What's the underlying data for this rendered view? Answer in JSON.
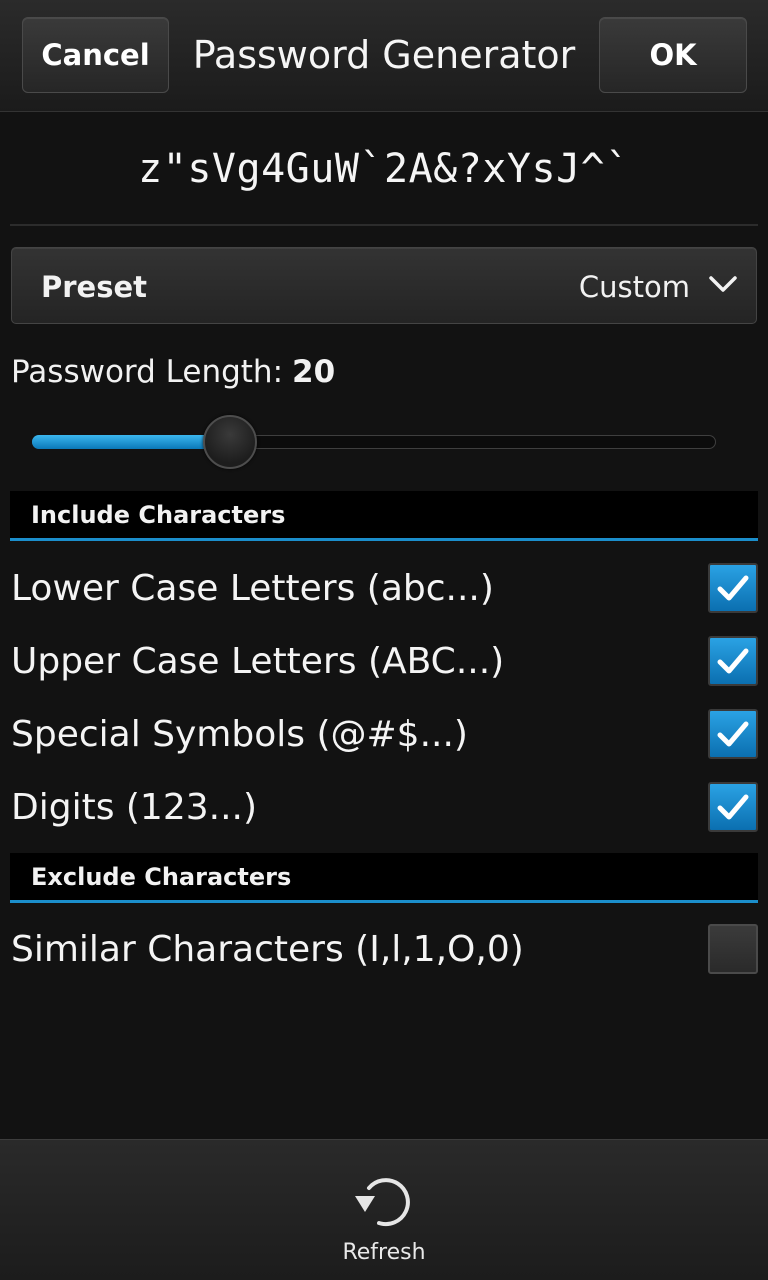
{
  "titlebar": {
    "cancel_label": "Cancel",
    "title": "Password Generator",
    "ok_label": "OK"
  },
  "password": "z\"sVg4GuW`2A&?xYsJ^`",
  "preset": {
    "label": "Preset",
    "value": "Custom",
    "icon": "chevron-down-icon"
  },
  "length": {
    "label": "Password Length:",
    "value": "20",
    "slider_fraction": 0.29
  },
  "include": {
    "title": "Include Characters",
    "items": [
      {
        "label": "Lower Case Letters (abc...)",
        "checked": true
      },
      {
        "label": "Upper Case Letters (ABC...)",
        "checked": true
      },
      {
        "label": "Special Symbols (@#$...)",
        "checked": true
      },
      {
        "label": "Digits (123...)",
        "checked": true
      }
    ]
  },
  "exclude": {
    "title": "Exclude Characters",
    "items": [
      {
        "label": "Similar Characters (I,l,1,O,0)",
        "checked": false
      }
    ]
  },
  "actionbar": {
    "refresh_label": "Refresh",
    "refresh_icon": "refresh-icon"
  },
  "colors": {
    "accent": "#1b8ecb",
    "checkbox_checked": "#1a8fd6",
    "background": "#121212"
  }
}
